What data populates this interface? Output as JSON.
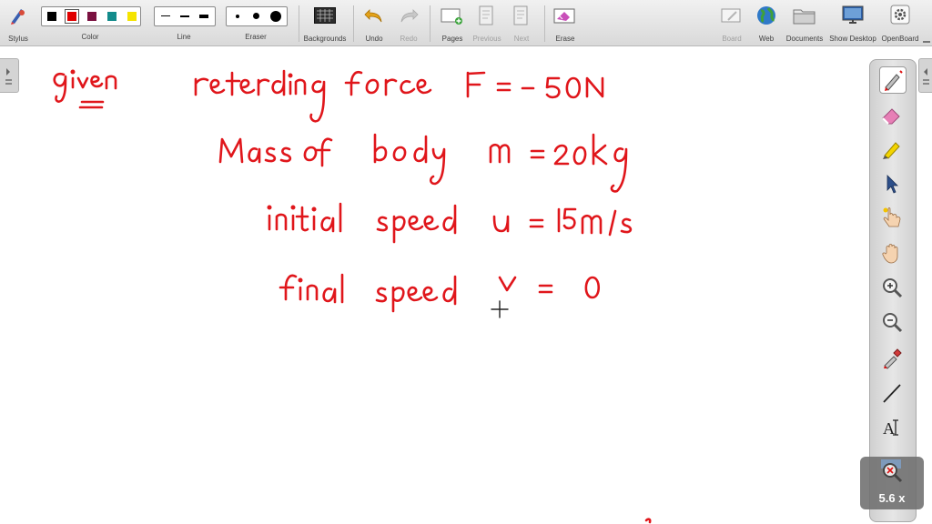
{
  "toolbar": {
    "stylus": "Stylus",
    "color": "Color",
    "line": "Line",
    "eraser": "Eraser",
    "backgrounds": "Backgrounds",
    "undo": "Undo",
    "redo": "Redo",
    "pages": "Pages",
    "previous": "Previous",
    "next": "Next",
    "erase": "Erase",
    "board": "Board",
    "web": "Web",
    "documents": "Documents",
    "show_desktop": "Show Desktop",
    "openboard": "OpenBoard"
  },
  "colors": {
    "swatches": [
      "#000000",
      "#e00000",
      "#7a1140",
      "#138b8b",
      "#f5e400"
    ],
    "ink": "#e0161b"
  },
  "tools": [
    "pen-icon",
    "eraser-icon",
    "marker-icon",
    "pointer-icon",
    "laser-hand-icon",
    "hand-icon",
    "zoom-in-icon",
    "zoom-out-icon",
    "pipette-icon",
    "line-icon",
    "text-icon",
    "magnifier-icon"
  ],
  "zoom": {
    "label": "5.6 x"
  },
  "board": {
    "lines": [
      {
        "label": "given",
        "text": "retarding force F = - 50N"
      },
      {
        "label": "",
        "text": "Mass of body m = 20kg"
      },
      {
        "label": "",
        "text": "initial speed u = 15m/s"
      },
      {
        "label": "",
        "text": "final speed v = 0"
      }
    ]
  }
}
